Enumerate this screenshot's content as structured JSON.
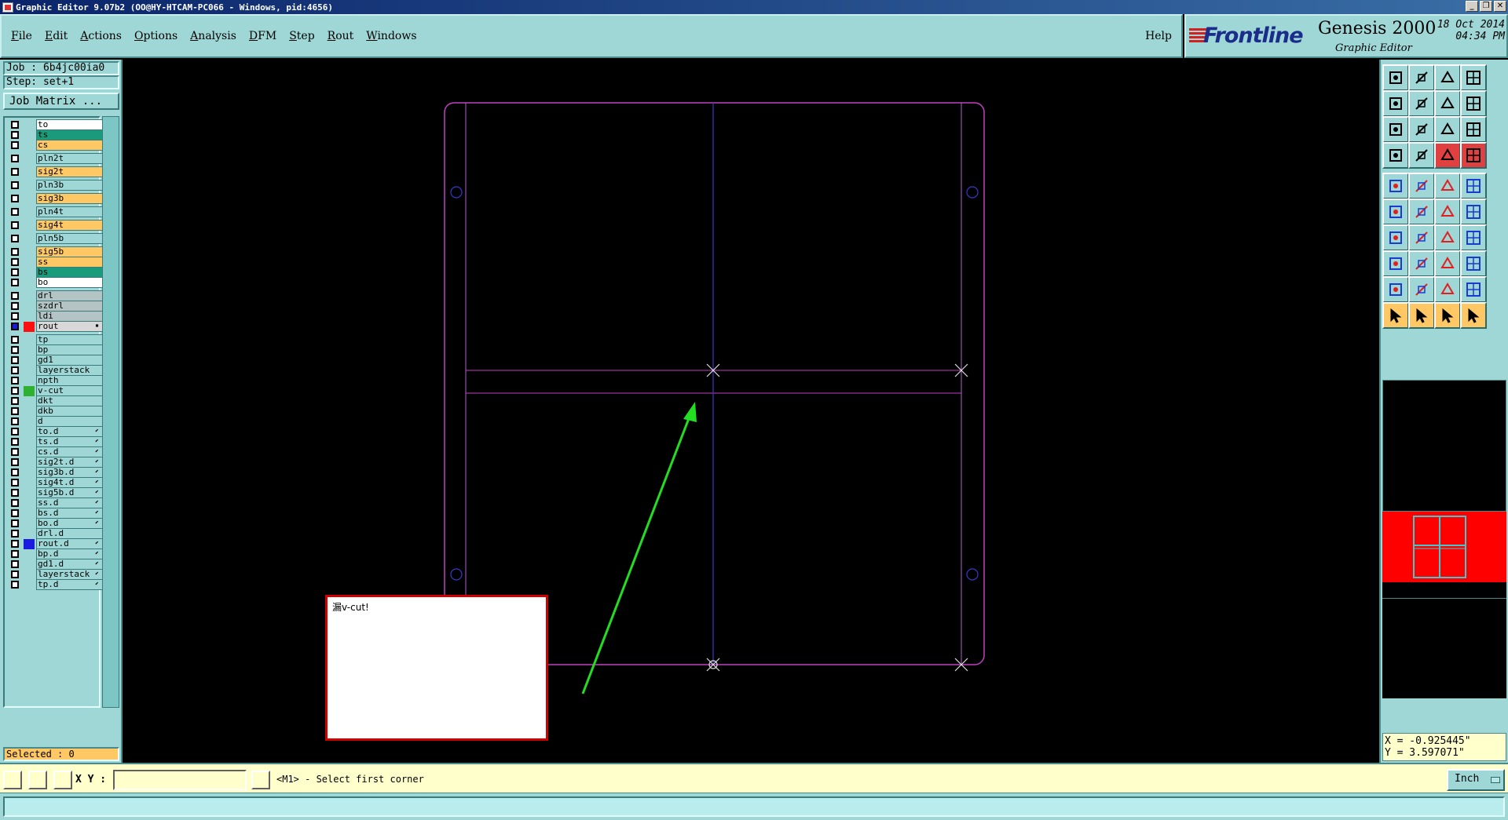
{
  "window": {
    "title": "Graphic Editor 9.07b2 (OO@HY-HTCAM-PC066 - Windows, pid:4656)"
  },
  "menu": [
    "File",
    "Edit",
    "Actions",
    "Options",
    "Analysis",
    "DFM",
    "Step",
    "Rout",
    "Windows"
  ],
  "help_label": "Help",
  "brand": {
    "logo": "Frontline",
    "product": "Genesis 2000",
    "subtitle": "Graphic Editor",
    "date": "18 Oct 2014",
    "time": "04:34 PM"
  },
  "job": {
    "label": "Job : 6b4jc00ia0",
    "step": "Step: set+1",
    "matrix_button": "Job Matrix ..."
  },
  "colors": {
    "teal": "#9fd7d7",
    "board_outline": "#c040c0",
    "vcut": "#3838c8",
    "arrow": "#22dd22",
    "highlight": "#ff0000"
  },
  "layers": [
    {
      "name": "to",
      "bg": "#ffffff",
      "sw": ""
    },
    {
      "name": "ts",
      "bg": "#1a9c7c",
      "sw": ""
    },
    {
      "name": "cs",
      "bg": "#ffc864",
      "sw": ""
    },
    {
      "name": "pln2t",
      "bg": "#9fd7d7",
      "sw": "",
      "gap": true
    },
    {
      "name": "sig2t",
      "bg": "#ffc864",
      "sw": "",
      "gap": true
    },
    {
      "name": "pln3b",
      "bg": "#9fd7d7",
      "sw": "",
      "gap": true
    },
    {
      "name": "sig3b",
      "bg": "#ffc864",
      "sw": "",
      "gap": true
    },
    {
      "name": "pln4t",
      "bg": "#9fd7d7",
      "sw": "",
      "gap": true
    },
    {
      "name": "sig4t",
      "bg": "#ffc864",
      "sw": "",
      "gap": true
    },
    {
      "name": "pln5b",
      "bg": "#9fd7d7",
      "sw": "",
      "gap": true
    },
    {
      "name": "sig5b",
      "bg": "#ffc864",
      "sw": "",
      "gap": true
    },
    {
      "name": "ss",
      "bg": "#ffc864",
      "sw": ""
    },
    {
      "name": "bs",
      "bg": "#1a9c7c",
      "sw": ""
    },
    {
      "name": "bo",
      "bg": "#ffffff",
      "sw": ""
    },
    {
      "name": "drl",
      "bg": "#b4c4c4",
      "sw": "",
      "gap": true
    },
    {
      "name": "szdrl",
      "bg": "#b4c4c4",
      "sw": ""
    },
    {
      "name": "ldi",
      "bg": "#b4c4c4",
      "sw": ""
    },
    {
      "name": "rout",
      "bg": "#d8d8d8",
      "sw": "#ff1010",
      "cb": "#1a1ae0",
      "mark": "▪"
    },
    {
      "name": "tp",
      "bg": "#9fd7d7",
      "sw": "",
      "gap": true
    },
    {
      "name": "bp",
      "bg": "#9fd7d7",
      "sw": ""
    },
    {
      "name": "gd1",
      "bg": "#9fd7d7",
      "sw": ""
    },
    {
      "name": "layerstack",
      "bg": "#9fd7d7",
      "sw": ""
    },
    {
      "name": "npth",
      "bg": "#9fd7d7",
      "sw": ""
    },
    {
      "name": "v-cut",
      "bg": "#9fd7d7",
      "sw": "#30b030"
    },
    {
      "name": "dkt",
      "bg": "#9fd7d7",
      "sw": ""
    },
    {
      "name": "dkb",
      "bg": "#9fd7d7",
      "sw": ""
    },
    {
      "name": "d",
      "bg": "#9fd7d7",
      "sw": ""
    },
    {
      "name": "to.d",
      "bg": "#9fd7d7",
      "sw": "",
      "mark": "⬋"
    },
    {
      "name": "ts.d",
      "bg": "#9fd7d7",
      "sw": "",
      "mark": "⬋"
    },
    {
      "name": "cs.d",
      "bg": "#9fd7d7",
      "sw": "",
      "mark": "⬋"
    },
    {
      "name": "sig2t.d",
      "bg": "#9fd7d7",
      "sw": "",
      "mark": "⬋"
    },
    {
      "name": "sig3b.d",
      "bg": "#9fd7d7",
      "sw": "",
      "mark": "⬋"
    },
    {
      "name": "sig4t.d",
      "bg": "#9fd7d7",
      "sw": "",
      "mark": "⬋"
    },
    {
      "name": "sig5b.d",
      "bg": "#9fd7d7",
      "sw": "",
      "mark": "⬋"
    },
    {
      "name": "ss.d",
      "bg": "#9fd7d7",
      "sw": "",
      "mark": "⬋"
    },
    {
      "name": "bs.d",
      "bg": "#9fd7d7",
      "sw": "",
      "mark": "⬋"
    },
    {
      "name": "bo.d",
      "bg": "#9fd7d7",
      "sw": "",
      "mark": "⬋"
    },
    {
      "name": "drl.d",
      "bg": "#9fd7d7",
      "sw": ""
    },
    {
      "name": "rout.d",
      "bg": "#9fd7d7",
      "sw": "#1a1ae0",
      "mark": "⬋"
    },
    {
      "name": "bp.d",
      "bg": "#9fd7d7",
      "sw": "",
      "mark": "⬋"
    },
    {
      "name": "gd1.d",
      "bg": "#9fd7d7",
      "sw": "",
      "mark": "⬋"
    },
    {
      "name": "layerstack",
      "bg": "#9fd7d7",
      "sw": "",
      "mark": "⬋"
    },
    {
      "name": "tp.d",
      "bg": "#9fd7d7",
      "sw": "",
      "mark": "⬋"
    }
  ],
  "selected_label": "Selected : 0",
  "message_box": "漏v-cut!",
  "tools": [
    "open-step-icon",
    "save-icon",
    "home-icon",
    "panes-icon",
    "pan-left-icon",
    "pan-right-icon",
    "undo-view-icon",
    "redraw-icon",
    "zoom-fit-icon",
    "zoom-home-icon",
    "zoom-1to2-icon",
    "help-icon",
    "settings-icon",
    "grid-icon",
    "features-icon",
    "layers-icon",
    "camera-icon",
    "select-box-icon",
    "measure-icon",
    "pad-icon",
    "connect-icon",
    "cross-icon",
    "node-icon",
    "node-red-icon",
    "line-icon",
    "slash-icon",
    "arc-icon",
    "snap-icon",
    "copy-icon",
    "minus-icon",
    "dimension-icon",
    "scale-icon",
    "triangle-red-icon",
    "triangle-icon",
    "triangle-bold-icon",
    "triangle-outline-icon",
    "pointer-icon",
    "pointer-box-icon",
    "pointer-info-icon",
    "pointer-route-icon"
  ],
  "coords": {
    "x": "X = -0.925445\"",
    "y": "Y = 3.597071\""
  },
  "status": {
    "xy_label": "X Y :",
    "xy_value": "",
    "prompt": "<M1> - Select first corner",
    "units": "Inch"
  }
}
